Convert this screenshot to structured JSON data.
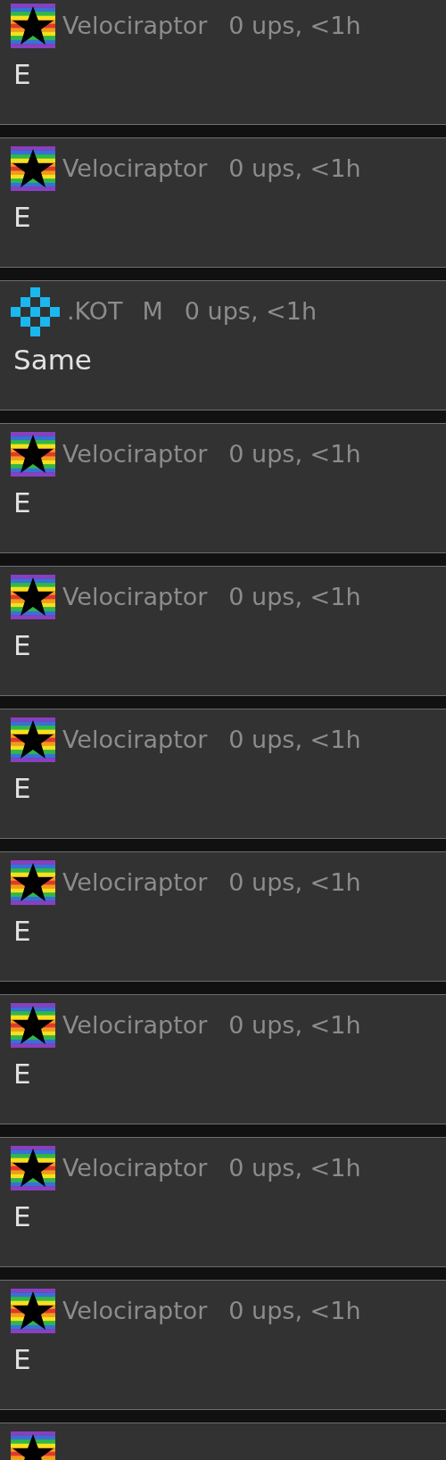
{
  "comments": [
    {
      "kind": "star",
      "user": "Velociraptor",
      "meta": "0 ups, <1h",
      "text": "E"
    },
    {
      "kind": "star",
      "user": "Velociraptor",
      "meta": "0 ups, <1h",
      "text": "E"
    },
    {
      "kind": "diamond",
      "user": ".KOT",
      "badge": "M",
      "meta": "0 ups, <1h",
      "text": "Same"
    },
    {
      "kind": "star",
      "user": "Velociraptor",
      "meta": "0 ups, <1h",
      "text": "E"
    },
    {
      "kind": "star",
      "user": "Velociraptor",
      "meta": "0 ups, <1h",
      "text": "E"
    },
    {
      "kind": "star",
      "user": "Velociraptor",
      "meta": "0 ups, <1h",
      "text": "E"
    },
    {
      "kind": "star",
      "user": "Velociraptor",
      "meta": "0 ups, <1h",
      "text": "E"
    },
    {
      "kind": "star",
      "user": "Velociraptor",
      "meta": "0 ups, <1h",
      "text": "E"
    },
    {
      "kind": "star",
      "user": "Velociraptor",
      "meta": "0 ups, <1h",
      "text": "E"
    },
    {
      "kind": "star",
      "user": "Velociraptor",
      "meta": "0 ups, <1h",
      "text": "E"
    },
    {
      "kind": "star"
    }
  ]
}
